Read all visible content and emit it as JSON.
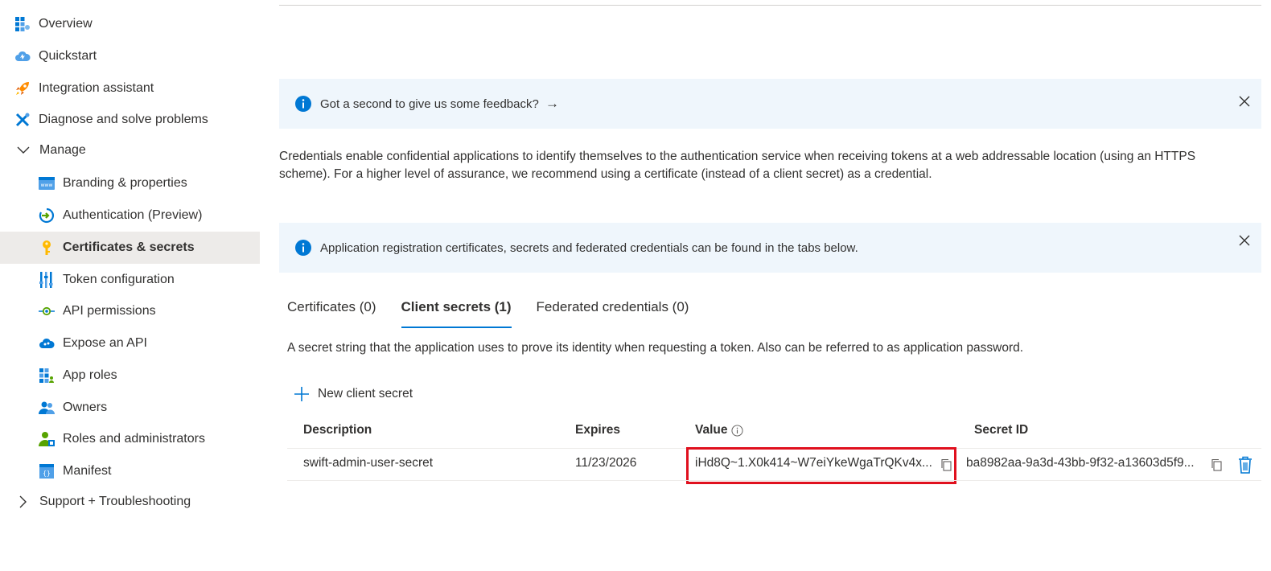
{
  "sidebar": {
    "items": [
      {
        "label": "Overview",
        "icon": "overview-grid-icon"
      },
      {
        "label": "Quickstart",
        "icon": "quickstart-cloud-icon"
      },
      {
        "label": "Integration assistant",
        "icon": "rocket-icon"
      },
      {
        "label": "Diagnose and solve problems",
        "icon": "tools-icon"
      },
      {
        "label": "Manage",
        "icon": "chevron-down-icon"
      },
      {
        "label": "Branding & properties",
        "icon": "branding-icon"
      },
      {
        "label": "Authentication (Preview)",
        "icon": "authentication-icon"
      },
      {
        "label": "Certificates & secrets",
        "icon": "key-icon",
        "selected": true
      },
      {
        "label": "Token configuration",
        "icon": "token-bars-icon"
      },
      {
        "label": "API permissions",
        "icon": "api-permissions-icon"
      },
      {
        "label": "Expose an API",
        "icon": "expose-api-cloud-icon"
      },
      {
        "label": "App roles",
        "icon": "app-roles-grid-icon"
      },
      {
        "label": "Owners",
        "icon": "owners-people-icon"
      },
      {
        "label": "Roles and administrators",
        "icon": "roles-admin-icon"
      },
      {
        "label": "Manifest",
        "icon": "manifest-icon"
      },
      {
        "label": "Support + Troubleshooting",
        "icon": "chevron-right-icon"
      }
    ]
  },
  "banners": {
    "feedback": {
      "text": "Got a second to give us some feedback?",
      "arrow": "→"
    },
    "info": {
      "text": "Application registration certificates, secrets and federated credentials can be found in the tabs below."
    }
  },
  "description": "Credentials enable confidential applications to identify themselves to the authentication service when receiving tokens at a web addressable location (using an HTTPS scheme). For a higher level of assurance, we recommend using a certificate (instead of a client secret) as a credential.",
  "tabs": [
    {
      "label": "Certificates (0)"
    },
    {
      "label": "Client secrets (1)",
      "active": true
    },
    {
      "label": "Federated credentials (0)"
    }
  ],
  "secrets_description": "A secret string that the application uses to prove its identity when requesting a token. Also can be referred to as application password.",
  "new_secret_label": "New client secret",
  "table": {
    "headers": {
      "description": "Description",
      "expires": "Expires",
      "value": "Value",
      "secret_id": "Secret ID"
    },
    "rows": [
      {
        "description": "swift-admin-user-secret",
        "expires": "11/23/2026",
        "value": "iHd8Q~1.X0k414~W7eiYkeWgaTrQKv4x...",
        "secret_id": "ba8982aa-9a3d-43bb-9f32-a13603d5f9..."
      }
    ]
  },
  "colors": {
    "accent": "#0078d4",
    "highlight": "#e0101e",
    "banner_bg": "#eff6fc",
    "selected_bg": "#edebe9",
    "delete": "#0078d4"
  }
}
